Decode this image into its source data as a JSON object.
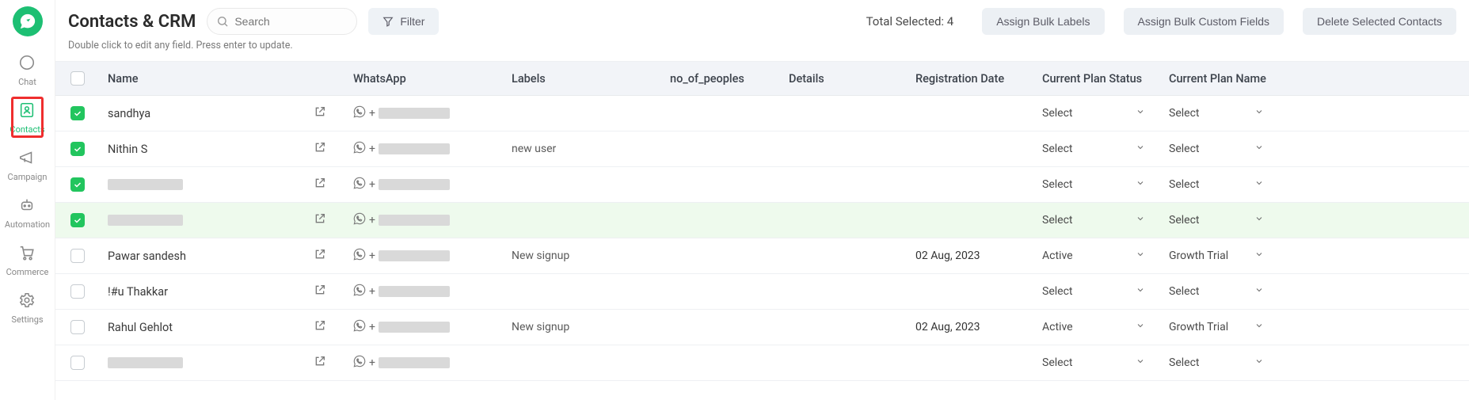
{
  "header": {
    "title": "Contacts & CRM",
    "search_placeholder": "Search",
    "filter_label": "Filter",
    "total_selected_label": "Total Selected: 4",
    "hint": "Double click to edit any field. Press enter to update.",
    "bulk_labels_btn": "Assign Bulk Labels",
    "bulk_custom_btn": "Assign Bulk Custom Fields",
    "delete_btn": "Delete Selected Contacts"
  },
  "sidebar": {
    "items": [
      "Chat",
      "Contacts",
      "Campaign",
      "Automation",
      "Commerce",
      "Settings"
    ],
    "active_index": 1
  },
  "columns": [
    "Name",
    "WhatsApp",
    "Labels",
    "no_of_peoples",
    "Details",
    "Registration Date",
    "Current Plan Status",
    "Current Plan Name"
  ],
  "rows": [
    {
      "checked": true,
      "name": "sandhya",
      "name_masked": false,
      "labels": "",
      "reg": "",
      "status": "Select",
      "plan": "Select",
      "hl": false
    },
    {
      "checked": true,
      "name": "Nithin S",
      "name_masked": false,
      "labels": "new user",
      "reg": "",
      "status": "Select",
      "plan": "Select",
      "hl": false
    },
    {
      "checked": true,
      "name": "",
      "name_masked": true,
      "labels": "",
      "reg": "",
      "status": "Select",
      "plan": "Select",
      "hl": false
    },
    {
      "checked": true,
      "name": "",
      "name_masked": true,
      "labels": "",
      "reg": "",
      "status": "Select",
      "plan": "Select",
      "hl": true
    },
    {
      "checked": false,
      "name": "Pawar sandesh",
      "name_masked": false,
      "labels": "New signup",
      "reg": "02 Aug, 2023",
      "status": "Active",
      "plan": "Growth Trial",
      "hl": false
    },
    {
      "checked": false,
      "name": "!#u Thakkar",
      "name_masked": false,
      "labels": "",
      "reg": "",
      "status": "Select",
      "plan": "Select",
      "hl": false
    },
    {
      "checked": false,
      "name": "Rahul Gehlot",
      "name_masked": false,
      "labels": "New signup",
      "reg": "02 Aug, 2023",
      "status": "Active",
      "plan": "Growth Trial",
      "hl": false
    },
    {
      "checked": false,
      "name": "",
      "name_masked": true,
      "labels": "",
      "reg": "",
      "status": "Select",
      "plan": "Select",
      "hl": false
    }
  ]
}
